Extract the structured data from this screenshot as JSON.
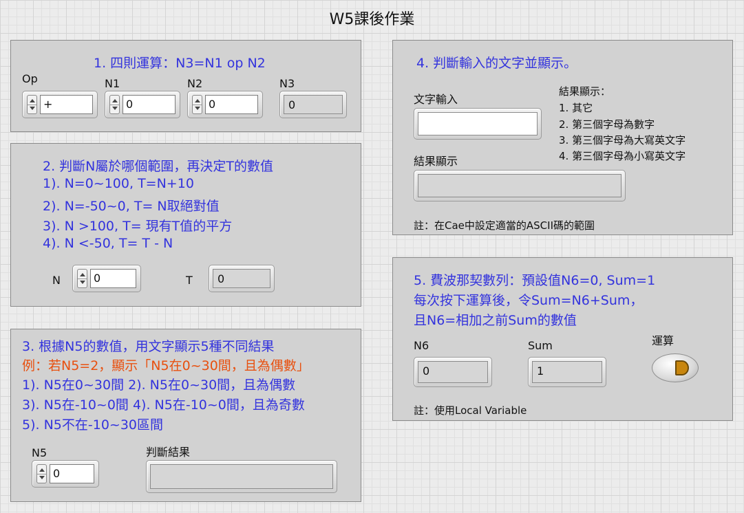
{
  "title": "W5課後作業",
  "panel1": {
    "heading": "1. 四則運算：N3=N1 op N2",
    "op": {
      "label": "Op",
      "value": "+"
    },
    "n1": {
      "label": "N1",
      "value": "0"
    },
    "n2": {
      "label": "N2",
      "value": "0"
    },
    "n3": {
      "label": "N3",
      "value": "0"
    }
  },
  "panel2": {
    "heading": "2. 判斷N屬於哪個範圍，再決定T的數值",
    "lines": [
      "1). N=0~100,  T=N+10",
      "2). N=-50~0, T= N取絕對值",
      "3). N >100, T= 現有T值的平方",
      "4). N <-50, T= T - N"
    ],
    "n": {
      "label": "N",
      "value": "0"
    },
    "t": {
      "label": "T",
      "value": "0"
    }
  },
  "panel3": {
    "heading": "3. 根據N5的數值，用文字顯示5種不同結果",
    "example": "例：若N5=2，顯示「N5在0~30間，且為偶數」",
    "lines": [
      "1). N5在0~30間   2). N5在0~30間，且為偶數",
      "3). N5在-10~0間   4). N5在-10~0間，且為奇數",
      "5). N5不在-10~30區間"
    ],
    "n5": {
      "label": "N5",
      "value": "0"
    },
    "result": {
      "label": "判斷結果",
      "value": ""
    }
  },
  "panel4": {
    "heading": "4. 判斷輸入的文字並顯示。",
    "input": {
      "label": "文字輸入",
      "value": ""
    },
    "output": {
      "label": "結果顯示",
      "value": ""
    },
    "legend_title": "結果顯示：",
    "legend": [
      "1. 其它",
      "2. 第三個字母為數字",
      "3. 第三個字母為大寫英文字",
      "4. 第三個字母為小寫英文字"
    ],
    "note": "註：在Cae中設定適當的ASCII碼的範圍"
  },
  "panel5": {
    "lines": [
      "5. 費波那契數列：預設值N6=0, Sum=1",
      "每次按下運算後，令Sum=N6+Sum，",
      "且N6=相加之前Sum的數值"
    ],
    "n6": {
      "label": "N6",
      "value": "0"
    },
    "sum": {
      "label": "Sum",
      "value": "1"
    },
    "run_label": "運算",
    "note": "註：使用Local Variable"
  },
  "colors": {
    "heading_blue": "#3333dd",
    "example_orange": "#e8500f",
    "panel_bg": "#d2d2d2",
    "run_knob": "#c8860e"
  },
  "icons": {
    "spinner": "up-down-arrows",
    "run_button": "boolean-button"
  }
}
